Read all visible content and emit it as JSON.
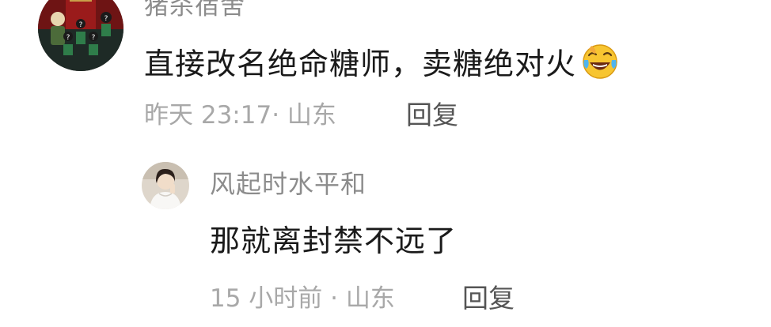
{
  "comment": {
    "username": "猪杀宿舍",
    "content": "直接改名绝命糖师，卖糖绝对火",
    "emoji": "face-with-tears-of-joy-icon",
    "meta": "昨天 23:17· 山东",
    "reply_label": "回复",
    "reply": {
      "username": "风起时水平和",
      "content": "那就离封禁不远了",
      "meta": "15 小时前 · 山东",
      "reply_label": "回复"
    }
  }
}
